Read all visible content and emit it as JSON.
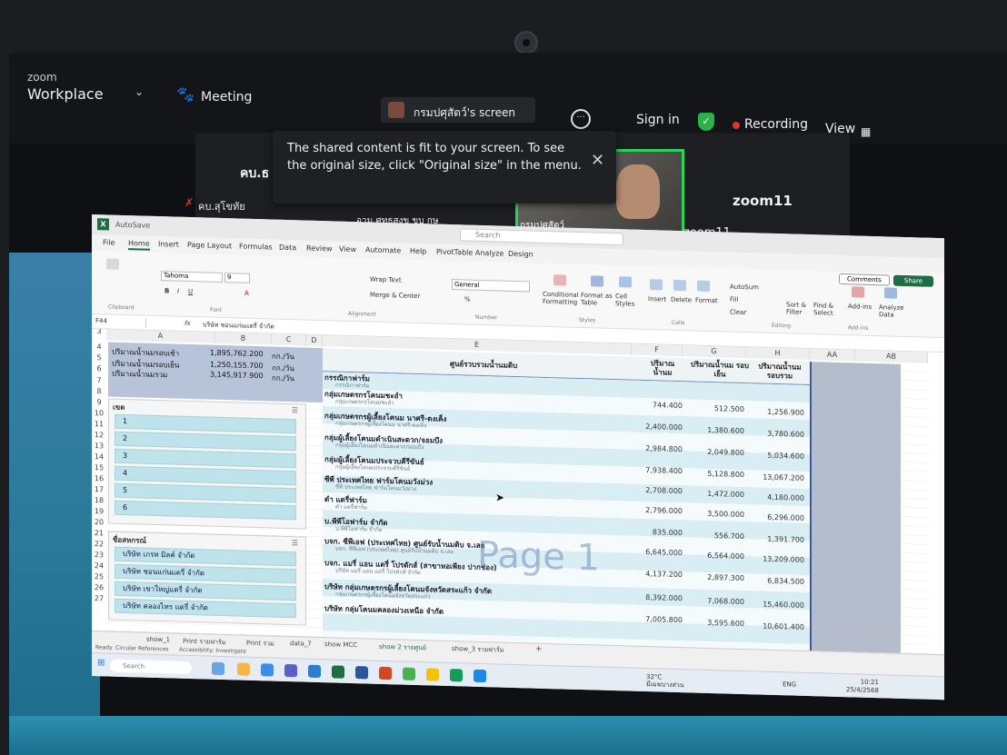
{
  "zoom": {
    "brand_small": "zoom",
    "brand": "Workplace",
    "meeting_label": "Meeting",
    "screen_share_label": "กรมปศุสัตว์'s screen",
    "more_label": "···",
    "sign_in": "Sign in",
    "recording": "Recording",
    "view": "View"
  },
  "toast": {
    "message": "The shared content is fit to your screen. To see the original size, click \"Original size\" in the menu.",
    "close": "✕"
  },
  "participants": {
    "left_name": "คบ.ธ",
    "left_sub": "คบ.สุโขทัย",
    "middle_name": "อาม ศุทธสงข ขบ กษ",
    "video_name": "กรมปศุสัตว์",
    "zoom11_a": "zoom11",
    "zoom11_b": "zoom11"
  },
  "excel": {
    "title_logo": "X",
    "autosave": "AutoSave",
    "search_placeholder": "Search",
    "menu": [
      "File",
      "Home",
      "Insert",
      "Page Layout",
      "Formulas",
      "Data",
      "Review",
      "View",
      "Automate",
      "Help",
      "PivotTable Analyze",
      "Design"
    ],
    "ribbon": {
      "font_name": "Tahoma",
      "font_size": "9",
      "wrap_text": "Wrap Text",
      "merge_center": "Merge & Center",
      "number_format": "General",
      "conditional": "Conditional Formatting",
      "format_table": "Format as Table",
      "cell_styles": "Cell Styles",
      "insert": "Insert",
      "delete": "Delete",
      "format": "Format",
      "autosum": "AutoSum",
      "fill": "Fill",
      "clear": "Clear",
      "sort_filter": "Sort & Filter",
      "find_select": "Find & Select",
      "addins": "Add-ins",
      "analyze_data": "Analyze Data",
      "comments": "Comments",
      "share": "Share",
      "groups": [
        "Clipboard",
        "Font",
        "Alignment",
        "Number",
        "Styles",
        "Cells",
        "Editing",
        "Add-ins"
      ]
    },
    "name_box": "F44",
    "formula": "บริษัท ชอนแก่นแดรี่ จำกัด",
    "columns": [
      "A",
      "B",
      "C",
      "D",
      "E",
      "F",
      "G",
      "H",
      "AA",
      "AB"
    ],
    "rows": [
      "3",
      "4",
      "5",
      "6",
      "7",
      "8",
      "9",
      "10",
      "11",
      "12",
      "13",
      "14",
      "15",
      "16",
      "17",
      "18",
      "19",
      "20",
      "21",
      "22",
      "23",
      "24",
      "25",
      "26",
      "27"
    ],
    "summary": [
      {
        "label": "ปริมาณน้ำนมรอบเช้า",
        "value": "1,895,762.200",
        "unit": "กก./วัน"
      },
      {
        "label": "ปริมาณน้ำนมรอบเย็น",
        "value": "1,250,155.700",
        "unit": "กก./วัน"
      },
      {
        "label": "ปริมาณน้ำนมรวม",
        "value": "3,145,917.900",
        "unit": "กก./วัน"
      }
    ],
    "slicer_zone": {
      "title": "เขต",
      "items": [
        "1",
        "2",
        "3",
        "4",
        "5",
        "6"
      ]
    },
    "slicer_coop": {
      "title": "ชื่อสหกรณ์",
      "items": [
        "บริษัท เกรท มิลค์ จำกัด",
        "บริษัท ชอนแก่นแดรี่ จำกัด",
        "บริษัท เขาใหญ่แดรี่ จำกัด",
        "บริษัท คลองไทร แดรี่ จำกัด"
      ]
    },
    "pivot_header": {
      "e": "ศูนย์รวบรวมน้ำนมดิบ",
      "f": "ปริมาณ น้ำนม",
      "g": "ปริมาณน้ำนม รอบเย็น",
      "h": "ปริมาณน้ำนม รอบรวม"
    },
    "pivot_rows": [
      {
        "name": "กรรณิกาฟาร์ม",
        "sub": "กรรณิกาฟาร์ม",
        "f": "",
        "g": "",
        "h": ""
      },
      {
        "name": "กลุ่มเกษตรกรโคนมชะอำ",
        "sub": "กลุ่มเกษตรกรโคนมชะอำ",
        "f": "744.400",
        "g": "512.500",
        "h": "1,256.900"
      },
      {
        "name": "กลุ่มเกษตรกรผู้เลี้ยงโคนม นาศรี-ดงเค็ง",
        "sub": "กลุ่มเกษตรกรผู้เลี้ยงโคนม นาศรี-ดงเค็ง",
        "f": "2,400.000",
        "g": "1,380.600",
        "h": "3,780.600"
      },
      {
        "name": "กลุ่มผู้เลี้ยงโคนมดำเนินสะดวก/จอมบึง",
        "sub": "กลุ่มผู้เลี้ยงโคนมดำเนินสะดวก/จอมบึง",
        "f": "2,984.800",
        "g": "2,049.800",
        "h": "5,034.600"
      },
      {
        "name": "กลุ่มผู้เลี้ยงโคนมประจวบคีรีขันธ์",
        "sub": "กลุ่มผู้เลี้ยงโคนมประจวบคีรีขันธ์",
        "f": "7,938.400",
        "g": "5,128.800",
        "h": "13,067.200"
      },
      {
        "name": "ซีพี ประเทศไทย ฟาร์มโคนมวังม่วง",
        "sub": "ซีพี ประเทศไทย ฟาร์มโคนมวังม่วง",
        "f": "2,708.000",
        "g": "1,472.000",
        "h": "4,180.000"
      },
      {
        "name": "ดำ แดรี่ฟาร์ม",
        "sub": "ดำ แดรี่ฟาร์ม",
        "f": "2,796.000",
        "g": "3,500.000",
        "h": "6,296.000"
      },
      {
        "name": "บ.พีพีโอฟาร์ม จำกัด",
        "sub": "บ.พีพีโอฟาร์ม จำกัด",
        "f": "835.000",
        "g": "556.700",
        "h": "1,391.700"
      },
      {
        "name": "บจก. ซีพีเอฟ (ประเทศไทย) ศูนย์รับน้ำนมดิบ จ.เลย",
        "sub": "บจก. ซีพีเอฟ (ประเทศไทย) ศูนย์รับน้ำนมดิบ จ.เลย",
        "f": "6,645.000",
        "g": "6,564.000",
        "h": "13,209.000"
      },
      {
        "name": "บจก. แมรี่ แอน แดรี่ โปรดักส์ (สาขาหอเพียง ปากช่อง)",
        "sub": "บริษัท แมรี่ แอน แดรี่ โปรดักส์ จำกัด",
        "f": "4,137.200",
        "g": "2,897.300",
        "h": "6,834.500"
      },
      {
        "name": "บริษัท กลุ่มเกษตรกรผู้เลี้ยงโคนมจังหวัดสระแก้ว จำกัด",
        "sub": "กลุ่มเกษตรกรผู้เลี้ยงโคนมจังหวัดสระแก้ว",
        "f": "8,392.000",
        "g": "7,068.000",
        "h": "15,460.000"
      },
      {
        "name": "บริษัท กลุ่มโคนมคลองม่วงเหนือ จำกัด",
        "sub": "",
        "f": "7,005.800",
        "g": "3,595.600",
        "h": "10,601.400"
      }
    ],
    "watermark": "Page 1",
    "sheet_tabs": [
      "show_1",
      "Print รายฟาร์ม",
      "Print รวม",
      "data_7",
      "show MCC",
      "show 2 รายศูนย์",
      "show_3 รายฟาร์ม"
    ],
    "status": [
      "Ready",
      "Circular References",
      "Accessibility: Investigate"
    ],
    "taskbar": {
      "search": "Search",
      "temp": "32°C",
      "temp_sub": "มีเมฆบางส่วน",
      "lang": "ENG",
      "time": "10:21",
      "date": "25/4/2568"
    }
  }
}
